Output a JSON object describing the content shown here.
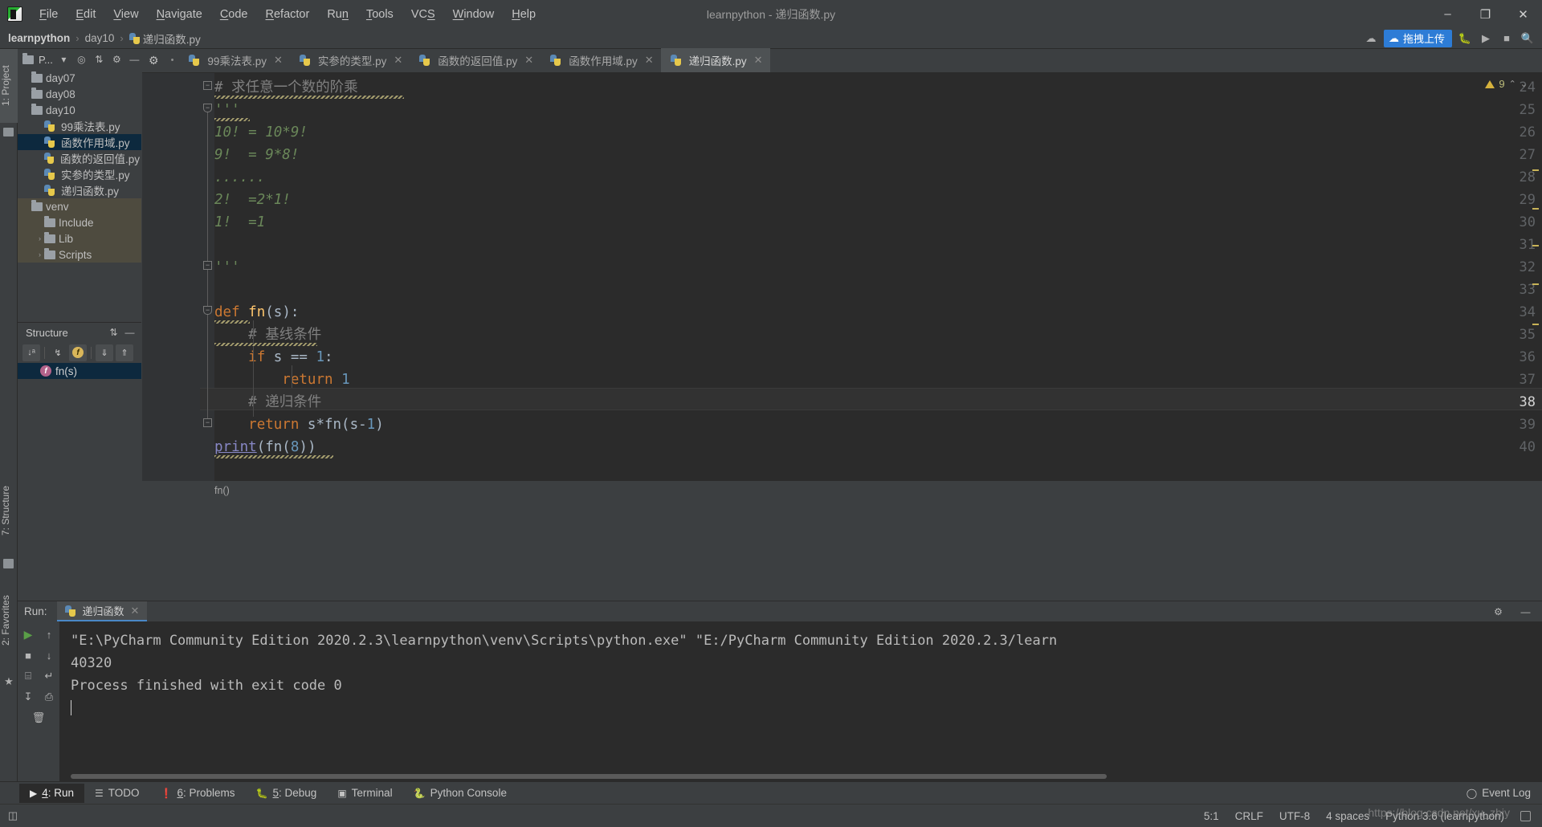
{
  "window": {
    "title": "learnpython - 递归函数.py",
    "logo_icon": "pycharm-logo-icon",
    "minimize_label": "–",
    "maximize_label": "❐",
    "close_label": "✕"
  },
  "menu": {
    "items": [
      {
        "label": "File",
        "accel": "F"
      },
      {
        "label": "Edit",
        "accel": "E"
      },
      {
        "label": "View",
        "accel": "V"
      },
      {
        "label": "Navigate",
        "accel": "N"
      },
      {
        "label": "Code",
        "accel": "C"
      },
      {
        "label": "Refactor",
        "accel": "R"
      },
      {
        "label": "Run",
        "accel": "n"
      },
      {
        "label": "Tools",
        "accel": "T"
      },
      {
        "label": "VCS",
        "accel": "S"
      },
      {
        "label": "Window",
        "accel": "W"
      },
      {
        "label": "Help",
        "accel": "H"
      }
    ]
  },
  "breadcrumb": {
    "project": "learnpython",
    "folder": "day10",
    "file": "递归函数.py",
    "separator": "›"
  },
  "navbar_right": {
    "upload_label": "拖拽上传",
    "cloud_icon": "cloud-upload-icon",
    "bug_icon": "bug-icon",
    "run_icon": "run-icon",
    "stop_icon": "stop-icon",
    "search_icon": "search-icon"
  },
  "left_strip": {
    "project_tab": "1: Project",
    "structure_tab": "7: Structure",
    "favorites_tab": "2: Favorites",
    "star_icon": "star-icon"
  },
  "project_panel": {
    "title": "P...",
    "dropdown_icon": "chevron-down-icon",
    "locate_icon": "crosshair-icon",
    "collapse_icon": "collapse-all-icon",
    "settings_icon": "gear-icon",
    "hide_icon": "hide-icon",
    "tree": [
      {
        "label": "day07",
        "type": "folder",
        "indent": 0,
        "selected": false,
        "arrow": ""
      },
      {
        "label": "day08",
        "type": "folder",
        "indent": 0,
        "selected": false,
        "arrow": ""
      },
      {
        "label": "day10",
        "type": "folder",
        "indent": 0,
        "selected": false,
        "arrow": ""
      },
      {
        "label": "99乘法表.py",
        "type": "python",
        "indent": 1,
        "selected": false,
        "arrow": ""
      },
      {
        "label": "函数作用域.py",
        "type": "python",
        "indent": 1,
        "selected": true,
        "arrow": ""
      },
      {
        "label": "函数的返回值.py",
        "type": "python",
        "indent": 1,
        "selected": false,
        "arrow": ""
      },
      {
        "label": "实参的类型.py",
        "type": "python",
        "indent": 1,
        "selected": false,
        "arrow": ""
      },
      {
        "label": "递归函数.py",
        "type": "python",
        "indent": 1,
        "selected": false,
        "arrow": ""
      },
      {
        "label": "venv",
        "type": "folder",
        "indent": 0,
        "selected": false,
        "arrow": "",
        "group": true
      },
      {
        "label": "Include",
        "type": "folder",
        "indent": 1,
        "selected": false,
        "arrow": "",
        "group": true
      },
      {
        "label": "Lib",
        "type": "folder",
        "indent": 1,
        "selected": false,
        "arrow": "›",
        "group": true
      },
      {
        "label": "Scripts",
        "type": "folder",
        "indent": 1,
        "selected": false,
        "arrow": "›",
        "group": true
      }
    ]
  },
  "structure_panel": {
    "title": "Structure",
    "expand_icon": "expand-collapse-icon",
    "toolbar": [
      {
        "name": "sort-alphabetically-icon",
        "glyph": "↓ᵃ₂"
      },
      {
        "name": "show-inherited-icon",
        "glyph": "ʏ"
      },
      {
        "name": "show-fields-icon",
        "glyph": "f"
      },
      {
        "name": "scroll-from-source-icon",
        "glyph": "⤓"
      },
      {
        "name": "scroll-to-source-icon",
        "glyph": "⤒"
      }
    ],
    "items": [
      {
        "label": "fn(s)",
        "icon": "function-icon",
        "selected": true
      }
    ]
  },
  "editor_tabs": [
    {
      "label": "99乘法表.py",
      "active": false,
      "close_label": "✕"
    },
    {
      "label": "实参的类型.py",
      "active": false,
      "close_label": "✕"
    },
    {
      "label": "函数的返回值.py",
      "active": false,
      "close_label": "✕"
    },
    {
      "label": "函数作用域.py",
      "active": false,
      "close_label": "✕"
    },
    {
      "label": "递归函数.py",
      "active": true,
      "close_label": "✕"
    }
  ],
  "editor": {
    "first_line_number": 24,
    "current_line": 38,
    "warning_count": "9",
    "warning_icon": "warning-triangle-icon",
    "up_icon": "⌃",
    "down_icon": "⌄",
    "breadcrumb_function": "fn()",
    "lines": [
      {
        "n": 24,
        "text": "# 求任意一个数的阶乘",
        "kind": "comment"
      },
      {
        "n": 25,
        "text": "'''",
        "kind": "string"
      },
      {
        "n": 26,
        "text": "10! = 10*9!",
        "kind": "string"
      },
      {
        "n": 27,
        "text": "9!  = 9*8!",
        "kind": "string"
      },
      {
        "n": 28,
        "text": "......",
        "kind": "string"
      },
      {
        "n": 29,
        "text": "2!  =2*1!",
        "kind": "string"
      },
      {
        "n": 30,
        "text": "1!  =1",
        "kind": "string"
      },
      {
        "n": 31,
        "text": "",
        "kind": "blank"
      },
      {
        "n": 32,
        "text": "'''",
        "kind": "string"
      },
      {
        "n": 33,
        "text": "",
        "kind": "blank"
      },
      {
        "n": 34,
        "text": "def fn(s):",
        "kind": "def"
      },
      {
        "n": 35,
        "text": "    # 基线条件",
        "kind": "comment"
      },
      {
        "n": 36,
        "text": "    if s == 1:",
        "kind": "code"
      },
      {
        "n": 37,
        "text": "        return 1",
        "kind": "code"
      },
      {
        "n": 38,
        "text": "    # 递归条件",
        "kind": "comment"
      },
      {
        "n": 39,
        "text": "    return s*fn(s-1)",
        "kind": "code"
      },
      {
        "n": 40,
        "text": "print(fn(8))",
        "kind": "call"
      }
    ]
  },
  "run_window": {
    "label": "Run:",
    "tab_label": "递归函数",
    "tab_close": "✕",
    "settings_icon": "gear-icon",
    "minimize_icon": "—",
    "sidebar_icons": [
      {
        "name": "rerun-icon",
        "glyph": "▶"
      },
      {
        "name": "scroll-up-icon",
        "glyph": "↑"
      },
      {
        "name": "stop-icon",
        "glyph": "■"
      },
      {
        "name": "scroll-down-icon",
        "glyph": "↓"
      },
      {
        "name": "toggle-tasks-icon",
        "glyph": "⌸"
      },
      {
        "name": "soft-wrap-icon",
        "glyph": "↵"
      },
      {
        "name": "scroll-end-icon",
        "glyph": "↧"
      },
      {
        "name": "print-icon",
        "glyph": "⎙"
      },
      {
        "name": "clear-all-icon",
        "glyph": "🗑"
      }
    ],
    "output": [
      "\"E:\\PyCharm Community Edition 2020.2.3\\learnpython\\venv\\Scripts\\python.exe\" \"E:/PyCharm Community Edition 2020.2.3/learn",
      "40320",
      "",
      "Process finished with exit code 0"
    ]
  },
  "bottom_bar": {
    "items": [
      {
        "label": "4: Run",
        "accel": "4",
        "icon": "run-icon",
        "active": true
      },
      {
        "label": "TODO",
        "accel": "",
        "icon": "todo-icon",
        "active": false
      },
      {
        "label": "6: Problems",
        "accel": "6",
        "icon": "problems-icon",
        "active": false
      },
      {
        "label": "5: Debug",
        "accel": "5",
        "icon": "debug-icon",
        "active": false
      },
      {
        "label": "Terminal",
        "accel": "",
        "icon": "terminal-icon",
        "active": false
      },
      {
        "label": "Python Console",
        "accel": "",
        "icon": "python-console-icon",
        "active": false
      }
    ],
    "event_log": "Event Log",
    "event_log_icon": "event-log-icon"
  },
  "status_bar": {
    "toggle_icon": "toggle-sidebar-icon",
    "caret_position": "5:1",
    "line_separator": "CRLF",
    "encoding": "UTF-8",
    "indent": "4 spaces",
    "interpreter": "Python 3.6 (learnpython)",
    "lock_icon": "lock-icon"
  },
  "watermark": "https://blog.csdn.net/xu_zhiy",
  "colors": {
    "accent_blue": "#2d7cd6",
    "selection": "#0d293e",
    "editor_bg": "#2b2b2b",
    "panel_bg": "#3c3f41",
    "string_green": "#6a8759",
    "keyword_orange": "#cc7832",
    "number_blue": "#6897bb",
    "def_yellow": "#ffc66d"
  }
}
